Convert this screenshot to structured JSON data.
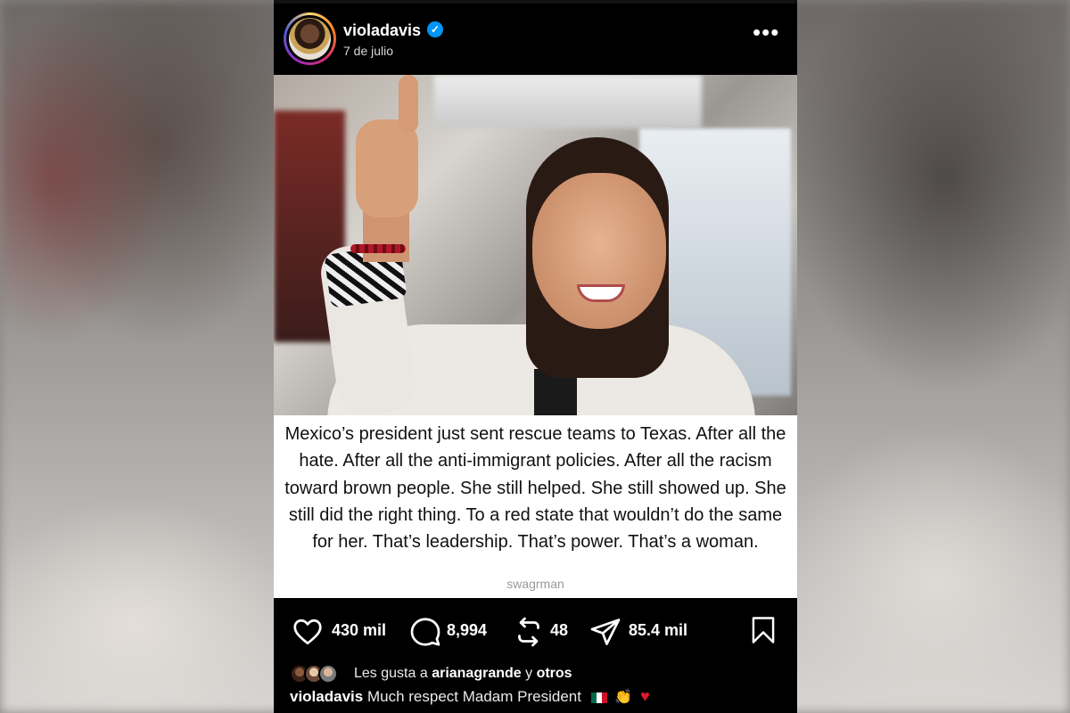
{
  "post": {
    "username": "violadavis",
    "date": "7 de julio",
    "verified_icon": "verified-badge-icon",
    "more_icon": "more-options-icon",
    "image_caption": "Mexico’s president just sent rescue teams to Texas. After all the hate. After all the anti-immigrant policies. After all the racism toward brown people. She still helped. She still showed up. She still did the right thing. To a red state that wouldn’t do the same for her. That’s leadership. That’s power. That’s a woman.",
    "image_credit": "swagrman"
  },
  "actions": {
    "likes": "430 mil",
    "comments": "8,994",
    "reposts": "48",
    "shares": "85.4 mil"
  },
  "liked_by": {
    "prefix": "Les gusta a",
    "user": "arianagrande",
    "joiner": "y",
    "others": "otros"
  },
  "comment": {
    "user": "violadavis",
    "text": "Much respect Madam President"
  },
  "colors": {
    "background": "#000000",
    "verified": "#0095f6",
    "text": "#ffffff"
  }
}
